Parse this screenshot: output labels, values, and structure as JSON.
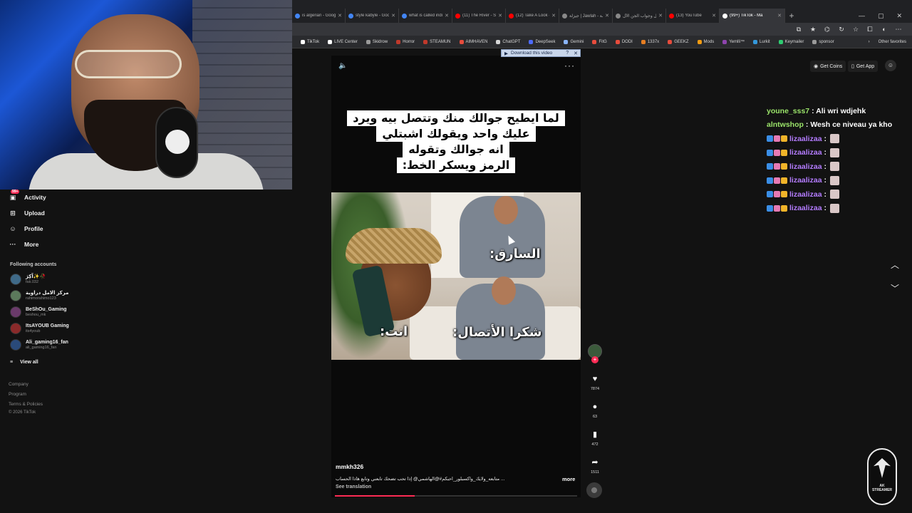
{
  "browser": {
    "tabs": [
      {
        "label": "is algerian - Goog",
        "color": "#4285f4"
      },
      {
        "label": "style kabyle - Google",
        "color": "#4285f4"
      },
      {
        "label": "what is called indian",
        "color": "#4285f4"
      },
      {
        "label": "(11) The River - Short",
        "color": "#ff0000"
      },
      {
        "label": "(12) Take A Look - Sh",
        "color": "#ff0000"
      },
      {
        "label": "جيزلة | Jawlah - منصة",
        "color": "#888888"
      },
      {
        "label": "سؤال وجواب الجن الأل",
        "color": "#888888"
      },
      {
        "label": "(13) YouTube",
        "color": "#ff0000"
      },
      {
        "label": "(99+) TikTok - Ma",
        "color": "#ffffff",
        "active": true
      }
    ],
    "new_tab": "+",
    "window_controls": {
      "minimize": "—",
      "maximize": "▢",
      "close": "✕"
    }
  },
  "bookmarks": {
    "items": [
      {
        "label": "TikTok",
        "color": "#ffffff"
      },
      {
        "label": "LIVE Center",
        "color": "#ffffff"
      },
      {
        "label": "Skidrow",
        "color": "#9a9a9a"
      },
      {
        "label": "Horror",
        "color": "#c0392b"
      },
      {
        "label": "STEAMUN",
        "color": "#c0392b"
      },
      {
        "label": "AIMHAVEN",
        "color": "#e74c3c"
      },
      {
        "label": "ChatGPT",
        "color": "#d6d6d6"
      },
      {
        "label": "DeepSeek",
        "color": "#4d6bfe"
      },
      {
        "label": "Gemini",
        "color": "#8ab4f8"
      },
      {
        "label": "FitG",
        "color": "#e74c3c"
      },
      {
        "label": "DODI",
        "color": "#e74c3c"
      },
      {
        "label": "1337x",
        "color": "#e67e22"
      },
      {
        "label": "GEEKZ",
        "color": "#e74c3c"
      },
      {
        "label": "Mods",
        "color": "#f39c12"
      },
      {
        "label": "Yemlli™",
        "color": "#8e44ad"
      },
      {
        "label": "Lurkit",
        "color": "#3498db"
      },
      {
        "label": "Keymailer",
        "color": "#2ecc71"
      },
      {
        "label": "sponsor",
        "color": "#9a9a9a"
      }
    ],
    "chevron": "›",
    "other_favorites": "Other favorites"
  },
  "sidebar": {
    "nav": [
      {
        "label": "Activity",
        "icon": "activity-icon",
        "glyph": "▣",
        "badge": "99+"
      },
      {
        "label": "Upload",
        "icon": "upload-icon",
        "glyph": "⊞"
      },
      {
        "label": "Profile",
        "icon": "profile-icon",
        "glyph": "☺"
      },
      {
        "label": "More",
        "icon": "more-icon",
        "glyph": "···"
      }
    ],
    "following_title": "Following accounts",
    "accounts": [
      {
        "name": "آكِرَ✨🥀",
        "handle": "fak.032"
      },
      {
        "name": "مركز الامل دراوية",
        "handle": "rahimorahimo123"
      },
      {
        "name": "BeShOu_Gaming",
        "handle": "beshou_mk"
      },
      {
        "name": "ItsAYOUB Gaming",
        "handle": "its4youb"
      },
      {
        "name": "Ali_gaming16_fan",
        "handle": "ali_gaming16_fan"
      }
    ],
    "view_all": "View all",
    "footer": [
      "Company",
      "Program",
      "Terms & Policies",
      "© 2026 TikTok"
    ]
  },
  "video": {
    "download_bar": "Download this video",
    "download_help": "?",
    "download_close": "✕",
    "volume_glyph": "🔈",
    "more_glyph": "···",
    "caption_lines": [
      "لما ايطيح جوالك منك وتتصل بيه ويرد",
      "عليك واحد ويقولك اشبتلي",
      "انه جوالك وتقوله",
      "الرمز ويسكر الخط:"
    ],
    "labels": {
      "thief": "السارق:",
      "you": "انت:",
      "thanks": "شكرا الأتصال:"
    },
    "author": "mmkh326",
    "description": "... متابعه_ولايك_واكسبلور_احبكم#@الهاشمي@ إذا تحب تضحك تابعني وتابع هاذا الحساب",
    "more": "more",
    "see_translation": "See translation",
    "progress": 0.33
  },
  "actions": {
    "like": {
      "glyph": "♥",
      "count": "7874"
    },
    "comment": {
      "glyph": "●",
      "count": "63"
    },
    "save": {
      "glyph": "▮",
      "count": "472"
    },
    "share": {
      "glyph": "➦",
      "count": "1511"
    },
    "follow_plus": "+"
  },
  "topbar": {
    "get_coins": "Get Coins",
    "get_app": "Get App",
    "coins_glyph": "◉",
    "app_glyph": "▯"
  },
  "chat": [
    {
      "user": "youne_sss7",
      "text": ": Ali wri wdjehk",
      "color": "#9be46a"
    },
    {
      "user": "alntwshop",
      "text": ": Wesh ce niveau ya kho",
      "color": "#9be46a"
    },
    {
      "user": "lizaalizaa",
      "text": ":",
      "color": "#b47cff",
      "badges": true,
      "emote": true
    },
    {
      "user": "lizaalizaa",
      "text": ":",
      "color": "#b47cff",
      "badges": true,
      "emote": true
    },
    {
      "user": "lizaalizaa",
      "text": ":",
      "color": "#b47cff",
      "badges": true,
      "emote": true
    },
    {
      "user": "lizaalizaa",
      "text": ":",
      "color": "#b47cff",
      "badges": true,
      "emote": true
    },
    {
      "user": "lizaalizaa",
      "text": ":",
      "color": "#b47cff",
      "badges": true,
      "emote": true
    },
    {
      "user": "lizaalizaa",
      "text": ":",
      "color": "#b47cff",
      "badges": true,
      "emote": true
    }
  ],
  "nav_arrows": {
    "up": "︿",
    "down": "﹀"
  },
  "logo_text": "AK\nSTREAMER"
}
